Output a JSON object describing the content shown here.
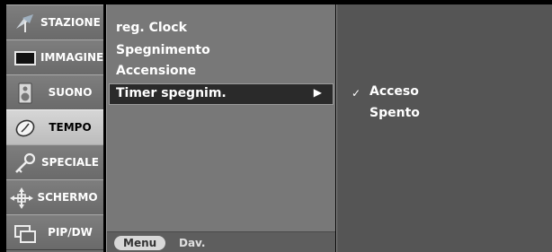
{
  "sidebar": {
    "items": [
      {
        "label": "STAZIONE",
        "icon": "antenna-icon"
      },
      {
        "label": "IMMAGINE",
        "icon": "picture-icon"
      },
      {
        "label": "SUONO",
        "icon": "speaker-icon"
      },
      {
        "label": "TEMPO",
        "icon": "clock-icon",
        "active": true
      },
      {
        "label": "SPECIALE",
        "icon": "key-icon"
      },
      {
        "label": "SCHERMO",
        "icon": "screen-adjust-icon"
      },
      {
        "label": "PIP/DW",
        "icon": "pip-icon"
      }
    ]
  },
  "middle_menu": {
    "items": [
      "reg. Clock",
      "Spegnimento",
      "Accensione"
    ],
    "selected": {
      "label": "Timer spegnim.",
      "arrow": "▶"
    }
  },
  "bottom_bar": {
    "menu_label": "Menu",
    "back_label": "Dav."
  },
  "submenu": {
    "options": [
      {
        "label": "Acceso",
        "checked": true,
        "check_mark": "✓"
      },
      {
        "label": "Spento",
        "checked": false
      }
    ]
  },
  "colors": {
    "active_tab": "#c8c8c8",
    "selected_row": "#2a2a2a",
    "panel": "#787878",
    "submenu": "#555555"
  }
}
